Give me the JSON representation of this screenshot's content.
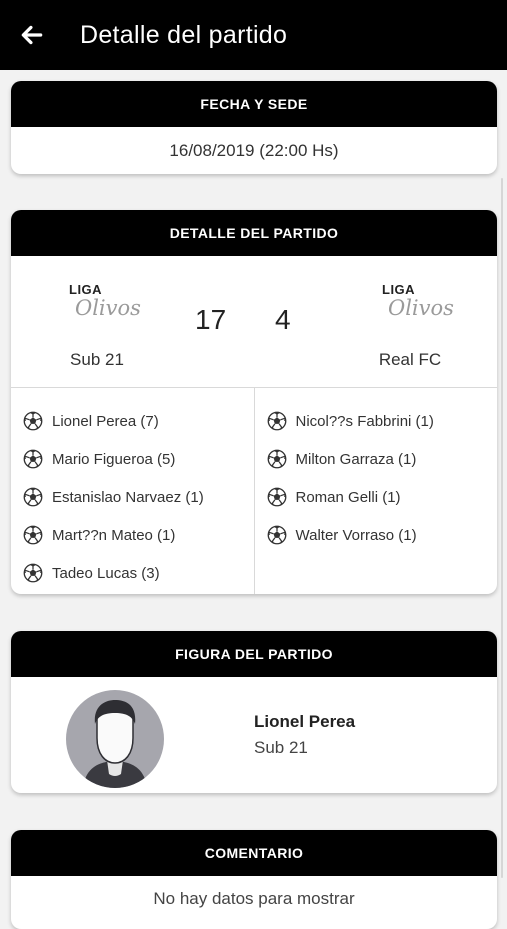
{
  "appbar": {
    "title": "Detalle del partido",
    "back_icon": "arrow-left-icon"
  },
  "fecha_sede": {
    "header": "FECHA Y SEDE",
    "datetime": "16/08/2019 (22:00 Hs)"
  },
  "detalle": {
    "header": "DETALLE DEL PARTIDO",
    "home": {
      "logo_top": "LIGA",
      "logo_script": "Olivos",
      "name": "Sub 21",
      "score": "17"
    },
    "away": {
      "logo_top": "LIGA",
      "logo_script": "Olivos",
      "name": "Real FC",
      "score": "4"
    },
    "home_scorers": [
      "Lionel Perea (7)",
      "Mario Figueroa (5)",
      "Estanislao Narvaez (1)",
      "Mart??n Mateo (1)",
      "Tadeo Lucas (3)"
    ],
    "away_scorers": [
      "Nicol??s Fabbrini (1)",
      "Milton Garraza (1)",
      "Roman Gelli (1)",
      "Walter Vorraso (1)"
    ]
  },
  "figura": {
    "header": "FIGURA DEL PARTIDO",
    "player_name": "Lionel Perea",
    "team": "Sub 21"
  },
  "comentario": {
    "header": "COMENTARIO",
    "empty_text": "No hay datos para mostrar"
  },
  "colors": {
    "header_bg": "#000000",
    "page_bg": "#f2f2f2",
    "card_bg": "#ffffff",
    "avatar_bg": "#a6a6ad"
  }
}
